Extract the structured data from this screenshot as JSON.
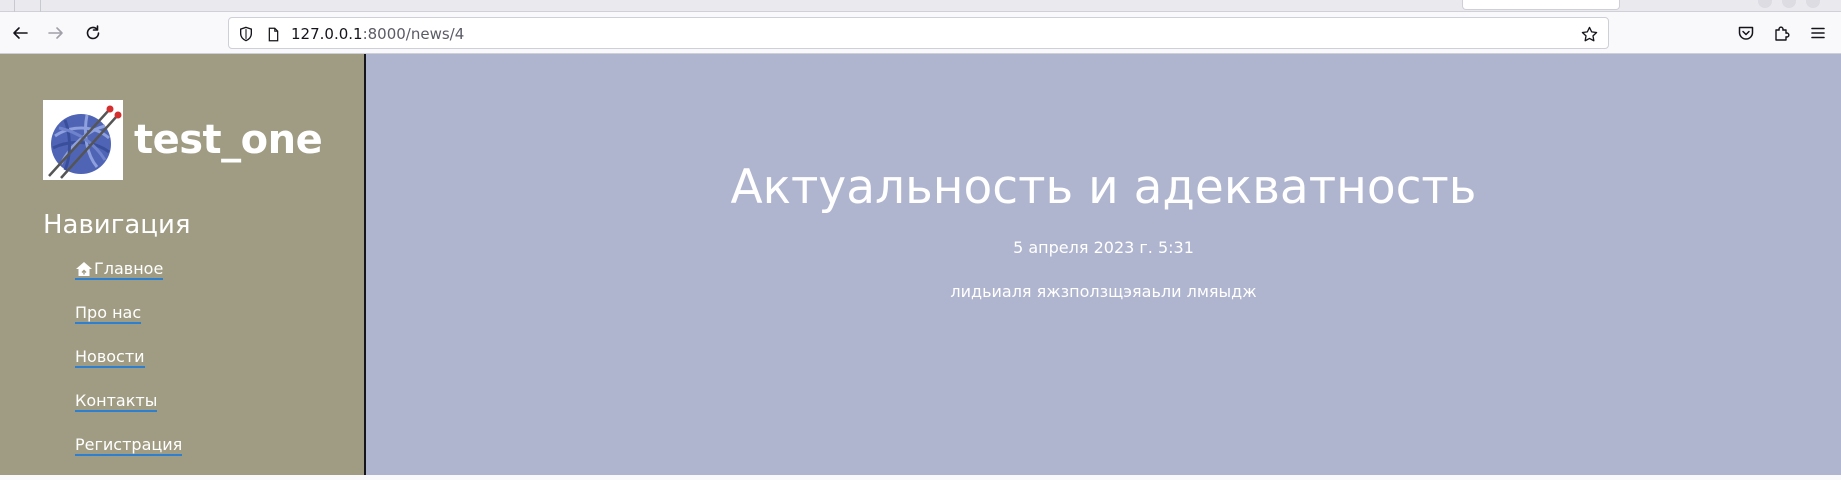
{
  "browser": {
    "url_host": "127.0.0.1",
    "url_path": ":8000/news/4"
  },
  "site": {
    "title": "test_one",
    "logo_icon": "yarn-ball-icon"
  },
  "navigation": {
    "heading": "Навигация",
    "items": [
      {
        "label": "Главное",
        "icon": "home-icon"
      },
      {
        "label": "Про нас"
      },
      {
        "label": "Новости"
      },
      {
        "label": "Контакты"
      },
      {
        "label": "Регистрация"
      }
    ]
  },
  "article": {
    "title": "Актуальность и адекватность",
    "date": "5 апреля 2023 г. 5:31",
    "body": "лидьиаля яжзползщэяаьли лмяыдж"
  },
  "colors": {
    "sidebar_bg": "#a09c83",
    "content_bg": "#b0b5cf",
    "link_underline": "#2e7fd0"
  }
}
